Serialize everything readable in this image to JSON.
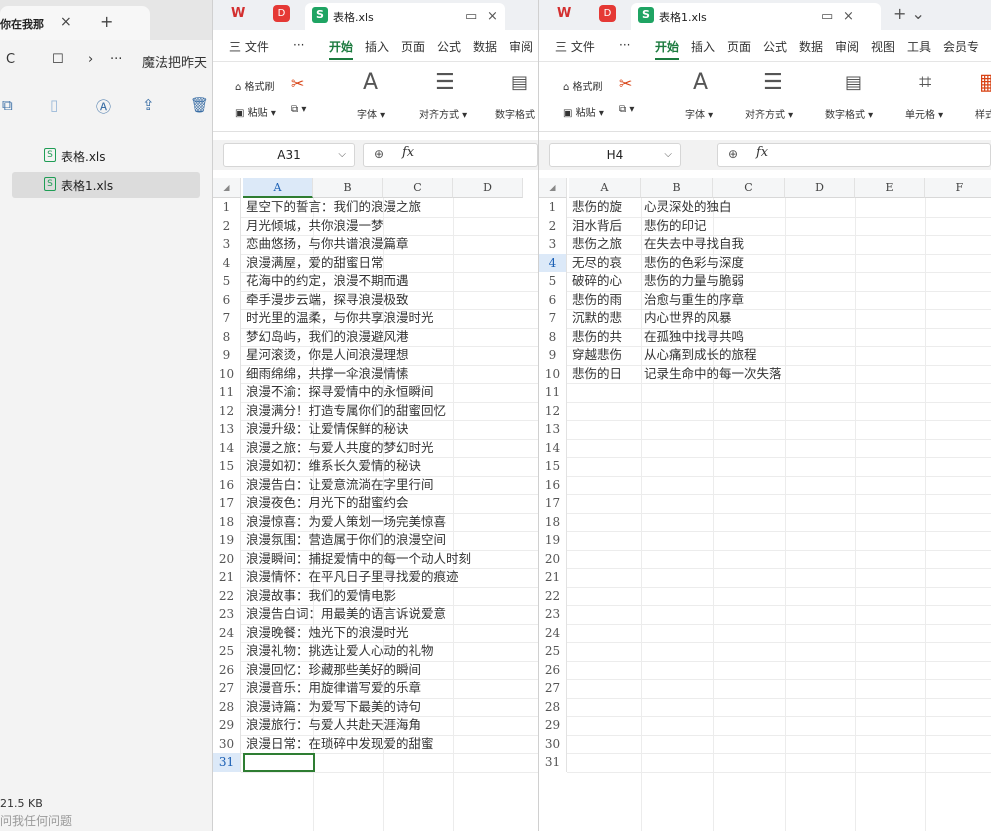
{
  "explorer": {
    "tab_title": "你在我那",
    "tab_close": "×",
    "tab_add": "+",
    "nav": {
      "refresh": "C",
      "monitor": "☐",
      "chevron": "›",
      "ellipsis": "···",
      "path": "魔法把昨天"
    },
    "files": [
      {
        "name": "表格.xls",
        "selected": false
      },
      {
        "name": "表格1.xls",
        "selected": true
      }
    ],
    "size_text": "21.5 KB",
    "bottom_text": "问我任何问题"
  },
  "window1": {
    "app_icons": [
      "W",
      "D"
    ],
    "doc_title": "表格.xls",
    "menus": [
      "三 文件",
      "···",
      "开始",
      "插入",
      "页面",
      "公式",
      "数据",
      "审阅"
    ],
    "active_menu": "开始",
    "ribbon": {
      "format_painter": "格式刷",
      "paste": "粘贴 ▾",
      "font": "字体 ▾",
      "align": "对齐方式 ▾",
      "number": "数字格式"
    },
    "name_box": "A31",
    "columns": [
      "A",
      "B",
      "C",
      "D"
    ],
    "selected_column": "A",
    "rows": [
      "星空下的誓言：我们的浪漫之旅",
      "月光倾城，共你浪漫一梦",
      "恋曲悠扬，与你共谱浪漫篇章",
      "浪漫满屋，爱的甜蜜日常",
      "花海中的约定，浪漫不期而遇",
      "牵手漫步云端，探寻浪漫极致",
      "时光里的温柔，与你共享浪漫时光",
      "梦幻岛屿，我们的浪漫避风港",
      "星河滚烫，你是人间浪漫理想",
      "细雨绵绵，共撑一伞浪漫情愫",
      "浪漫不渝：探寻爱情中的永恒瞬间",
      "浪漫满分！打造专属你们的甜蜜回忆",
      "浪漫升级：让爱情保鲜的秘诀",
      "浪漫之旅：与爱人共度的梦幻时光",
      "浪漫如初：维系长久爱情的秘诀",
      "浪漫告白：让爱意流淌在字里行间",
      "浪漫夜色：月光下的甜蜜约会",
      "浪漫惊喜：为爱人策划一场完美惊喜",
      "浪漫氛围：营造属于你们的浪漫空间",
      "浪漫瞬间：捕捉爱情中的每一个动人时刻",
      "浪漫情怀：在平凡日子里寻找爱的痕迹",
      "浪漫故事：我们的爱情电影",
      "浪漫告白词：用最美的语言诉说爱意",
      "浪漫晚餐：烛光下的浪漫时光",
      "浪漫礼物：挑选让爱人心动的礼物",
      "浪漫回忆：珍藏那些美好的瞬间",
      "浪漫音乐：用旋律谱写爱的乐章",
      "浪漫诗篇：为爱写下最美的诗句",
      "浪漫旅行：与爱人共赴天涯海角",
      "浪漫日常：在琐碎中发现爱的甜蜜",
      ""
    ],
    "row_numbers": [
      "1",
      "2",
      "3",
      "4",
      "5",
      "6",
      "7",
      "8",
      "9",
      "10",
      "11",
      "12",
      "13",
      "14",
      "15",
      "16",
      "17",
      "18",
      "19",
      "20",
      "21",
      "22",
      "23",
      "24",
      "25",
      "26",
      "27",
      "28",
      "29",
      "30",
      "31"
    ],
    "selected_row": "31"
  },
  "window2": {
    "app_icons": [
      "W",
      "D"
    ],
    "doc_title": "表格1.xls",
    "menus": [
      "三 文件",
      "···",
      "开始",
      "插入",
      "页面",
      "公式",
      "数据",
      "审阅",
      "视图",
      "工具",
      "会员专"
    ],
    "active_menu": "开始",
    "ribbon": {
      "format_painter": "格式刷",
      "paste": "粘贴 ▾",
      "font": "字体 ▾",
      "align": "对齐方式 ▾",
      "number": "数字格式 ▾",
      "cell": "单元格 ▾",
      "style": "样式"
    },
    "name_box": "H4",
    "columns": [
      "A",
      "B",
      "C",
      "D",
      "E",
      "F"
    ],
    "rows": [
      [
        "悲伤的旋",
        "心灵深处的独白"
      ],
      [
        "泪水背后",
        "悲伤的印记"
      ],
      [
        "悲伤之旅",
        "在失去中寻找自我"
      ],
      [
        "无尽的哀",
        "悲伤的色彩与深度"
      ],
      [
        "破碎的心",
        "悲伤的力量与脆弱"
      ],
      [
        "悲伤的雨",
        "治愈与重生的序章"
      ],
      [
        "沉默的悲",
        "内心世界的风暴"
      ],
      [
        "悲伤的共",
        "在孤独中找寻共鸣"
      ],
      [
        "穿越悲伤",
        "从心痛到成长的旅程"
      ],
      [
        "悲伤的日",
        "记录生命中的每一次失落"
      ]
    ],
    "row_numbers": [
      "1",
      "2",
      "3",
      "4",
      "5",
      "6",
      "7",
      "8",
      "9",
      "10",
      "11",
      "12",
      "13",
      "14",
      "15",
      "16",
      "17",
      "18",
      "19",
      "20",
      "21",
      "22",
      "23",
      "24",
      "25",
      "26",
      "27",
      "28",
      "29",
      "30",
      "31"
    ],
    "selected_row": "4"
  }
}
